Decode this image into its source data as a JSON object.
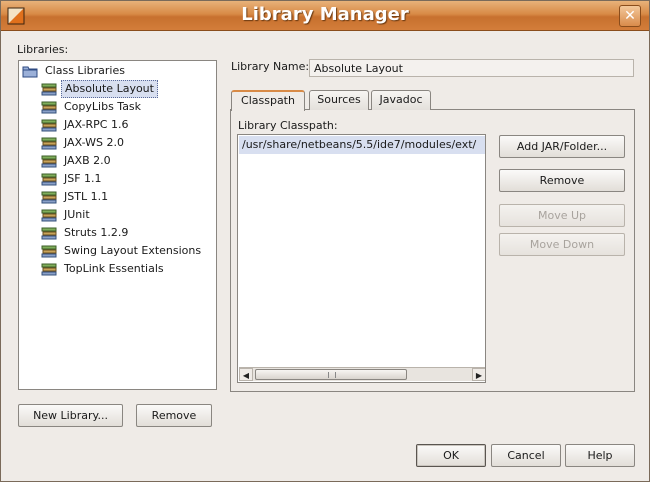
{
  "window": {
    "title": "Library Manager",
    "close_glyph": "✕"
  },
  "libraries": {
    "label": "Libraries:",
    "root": "Class Libraries",
    "selected_index": 0,
    "items": [
      "Absolute Layout",
      "CopyLibs Task",
      "JAX-RPC 1.6",
      "JAX-WS 2.0",
      "JAXB 2.0",
      "JSF 1.1",
      "JSTL 1.1",
      "JUnit",
      "Struts 1.2.9",
      "Swing Layout Extensions",
      "TopLink Essentials"
    ]
  },
  "library_name": {
    "label": "Library Name:",
    "value": "Absolute Layout"
  },
  "tabs": [
    "Classpath",
    "Sources",
    "Javadoc"
  ],
  "active_tab": "Classpath",
  "classpath": {
    "label": "Library Classpath:",
    "entries": [
      "/usr/share/netbeans/5.5/ide7/modules/ext/"
    ]
  },
  "side_buttons": {
    "add": "Add JAR/Folder...",
    "remove": "Remove",
    "move_up": "Move Up",
    "move_down": "Move Down"
  },
  "bottom_left": {
    "new_library": "New Library...",
    "remove": "Remove"
  },
  "dialog_buttons": {
    "ok": "OK",
    "cancel": "Cancel",
    "help": "Help"
  },
  "colors": {
    "title_accent": "#d88a46",
    "selection": "#d8dff0"
  }
}
